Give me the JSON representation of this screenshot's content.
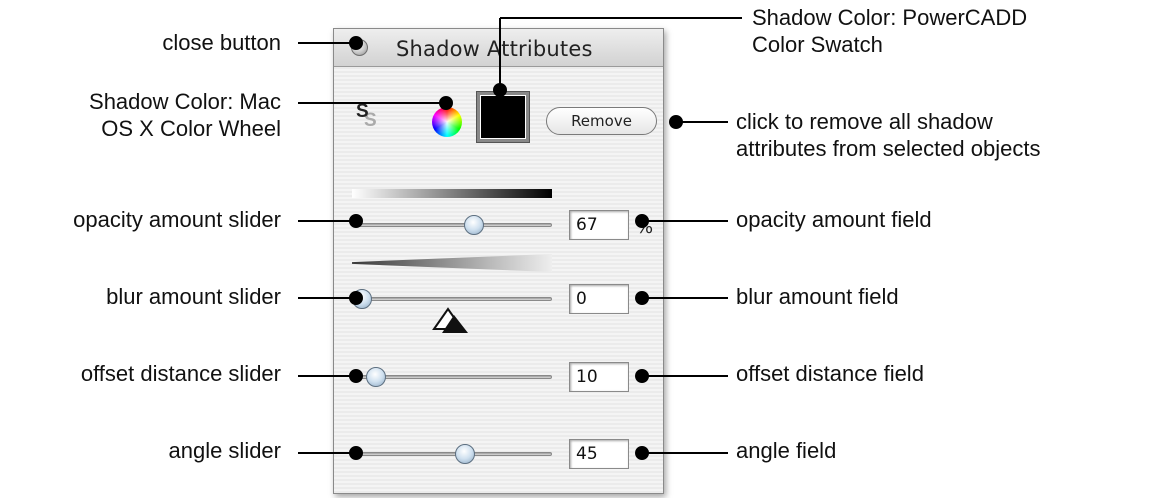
{
  "panel": {
    "title": "Shadow Attributes",
    "remove_label": "Remove",
    "shadow_color": "#000000",
    "opacity": {
      "value": "67",
      "unit": "%",
      "slider_fraction": 0.62
    },
    "blur": {
      "value": "0",
      "slider_fraction": 0.0
    },
    "offset": {
      "value": "10",
      "slider_fraction": 0.08
    },
    "angle": {
      "value": "45",
      "slider_fraction": 0.57
    }
  },
  "callouts": {
    "close_button": "close button",
    "color_wheel": [
      "Shadow Color: Mac",
      "OS X Color Wheel"
    ],
    "swatch": [
      "Shadow Color: PowerCADD",
      "Color Swatch"
    ],
    "remove": [
      "click to remove all shadow",
      "attributes from selected objects"
    ],
    "opacity_slider": "opacity amount slider",
    "opacity_field": "opacity amount field",
    "blur_slider": "blur amount slider",
    "blur_field": "blur amount field",
    "offset_slider": "offset distance slider",
    "offset_field": "offset distance field",
    "angle_slider": "angle slider",
    "angle_field": "angle field"
  },
  "icons": {
    "close": "close-icon",
    "shadow_text": "shadow-text-icon",
    "color_wheel": "color-wheel-icon",
    "offset": "offset-triangle-icon"
  }
}
